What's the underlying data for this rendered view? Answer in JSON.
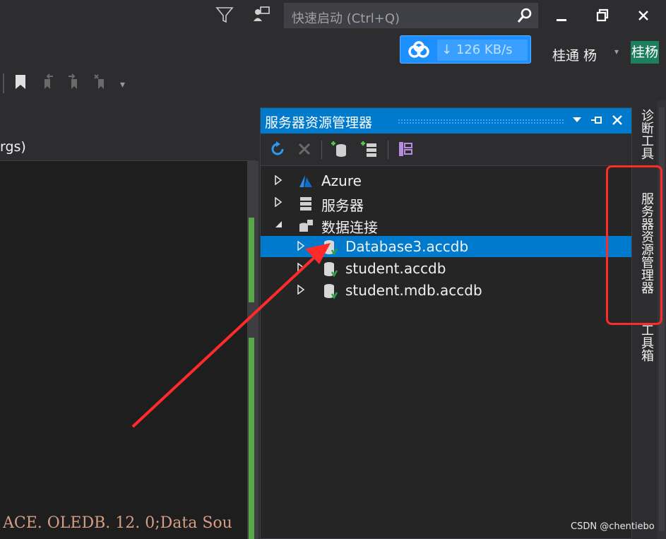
{
  "titlebar": {
    "quick_launch_placeholder": "快速启动 (Ctrl+Q)",
    "filter_icon": "filter-icon",
    "feedback_icon": "feedback-icon",
    "search_icon": "search-icon"
  },
  "download": {
    "rate_arrow": "↓",
    "rate_value": "126",
    "rate_unit": "KB/s",
    "icon": "cloud-icon",
    "color": "#1e8fff"
  },
  "account": {
    "username": "桂通 杨",
    "dropdown": "▾",
    "avatar_text": "桂杨",
    "avatar_color": "#1e7f5c"
  },
  "editor": {
    "tab_label": "rgs)",
    "code_text": "ACE. OLEDB. 12. 0;Data Sou"
  },
  "server_explorer": {
    "title": "服务器资源管理器",
    "accent": "#007acc",
    "toolbar": {
      "refresh": "refresh-icon",
      "stop": "stop-icon",
      "connect_db": "connect-database-icon",
      "connect_server": "connect-server-icon",
      "sharepoint": "sharepoint-icon"
    },
    "tree": [
      {
        "label": "Azure",
        "icon": "azure-icon",
        "expanded": false,
        "depth": 0
      },
      {
        "label": "服务器",
        "icon": "servers-icon",
        "expanded": false,
        "depth": 0
      },
      {
        "label": "数据连接",
        "icon": "data-connections-icon",
        "expanded": true,
        "depth": 0
      },
      {
        "label": "Database3.accdb",
        "icon": "database-icon",
        "expanded": false,
        "depth": 1,
        "selected": true
      },
      {
        "label": "student.accdb",
        "icon": "database-icon",
        "expanded": false,
        "depth": 1
      },
      {
        "label": "student.mdb.accdb",
        "icon": "database-icon",
        "expanded": false,
        "depth": 1
      }
    ]
  },
  "side_tabs": {
    "diagnostics": "诊断工具",
    "server_explorer": "服务器资源管理器",
    "toolbox": "工具箱"
  },
  "watermark": "CSDN @chentiebo",
  "annotation_color": "#ff2a2a"
}
